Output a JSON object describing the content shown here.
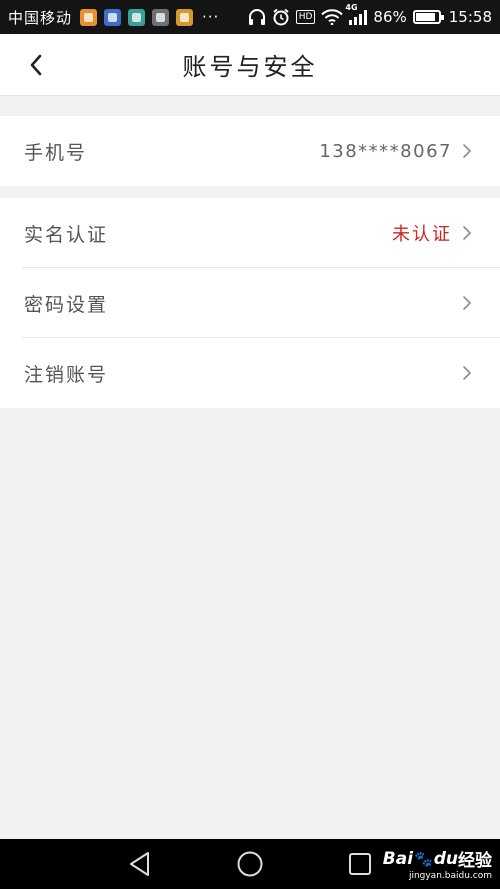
{
  "status_bar": {
    "carrier": "中国移动",
    "dots": "···",
    "hd": "HD",
    "network": "4G",
    "battery_percent": "86%",
    "battery_level": 0.86,
    "time": "15:58"
  },
  "header": {
    "title": "账号与安全"
  },
  "groups": [
    {
      "items": [
        {
          "label": "手机号",
          "value": "138****8067"
        }
      ]
    },
    {
      "items": [
        {
          "label": "实名认证",
          "value": "未认证"
        },
        {
          "label": "密码设置",
          "value": ""
        },
        {
          "label": "注销账号",
          "value": ""
        }
      ]
    }
  ],
  "watermark": {
    "brand": "Bai",
    "brand_tail": "du",
    "paw": "🐾",
    "suffix": "经验",
    "url": "jingyan.baidu.com"
  },
  "colors": {
    "warning": "#d0241c",
    "background": "#f2f2f4",
    "status_bar": "#141414"
  }
}
